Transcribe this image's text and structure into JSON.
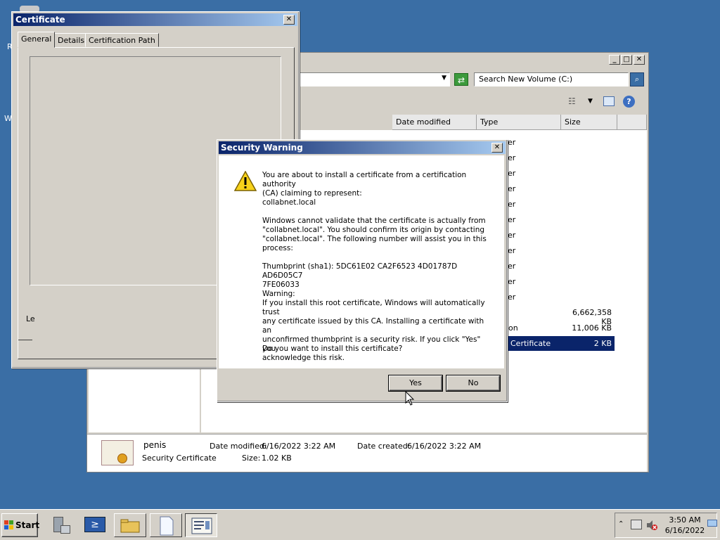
{
  "desktop": {
    "fragments": [
      "R",
      "W"
    ]
  },
  "explorer": {
    "search_placeholder": "Search New Volume (C:)",
    "columns": [
      "Date modified",
      "Type",
      "Size"
    ],
    "type_fragments": [
      "er",
      "er",
      "er",
      "er",
      "er",
      "er",
      "er",
      "er",
      "er",
      "er",
      "er"
    ],
    "rows": [
      {
        "type": "",
        "size": "6,662,358 KB"
      },
      {
        "type": "ion",
        "size": "11,006 KB"
      },
      {
        "type": "Certificate",
        "size": "2 KB",
        "selected": true
      }
    ],
    "details": {
      "name": "penis",
      "kind": "Security Certificate",
      "date_modified_label": "Date modified:",
      "date_modified": "6/16/2022 3:22 AM",
      "date_created_label": "Date created:",
      "date_created": "6/16/2022 3:22 AM",
      "size_label": "Size:",
      "size": "1.02 KB"
    }
  },
  "cert": {
    "title": "Certificate",
    "tabs": [
      "General",
      "Details",
      "Certification Path"
    ],
    "fragment": "Le"
  },
  "secwarn": {
    "title": "Security Warning",
    "p1": "You are about to install a certificate from a certification authority\n(CA) claiming to represent:",
    "p2": "collabnet.local",
    "p3": "Windows cannot validate that the certificate is actually from\n\"collabnet.local\". You should confirm its origin by contacting\n\"collabnet.local\". The following number will assist you in this\nprocess:",
    "p4": "Thumbprint (sha1): 5DC61E02 CA2F6523 4D01787D AD6D05C7\n7FE06033",
    "p5": "Warning:\nIf you install this root certificate, Windows will automatically trust\nany certificate issued by this CA. Installing a certificate with an\nunconfirmed thumbprint is a security risk. If you click \"Yes\" you\nacknowledge this risk.",
    "p6": "Do you want to install this certificate?",
    "yes": "Yes",
    "no": "No"
  },
  "taskbar": {
    "start": "Start",
    "time": "3:50 AM",
    "date": "6/16/2022"
  },
  "colors": {
    "desktop": "#3a6ea5",
    "title_active": "#0a246a",
    "selection": "#0a246a"
  }
}
